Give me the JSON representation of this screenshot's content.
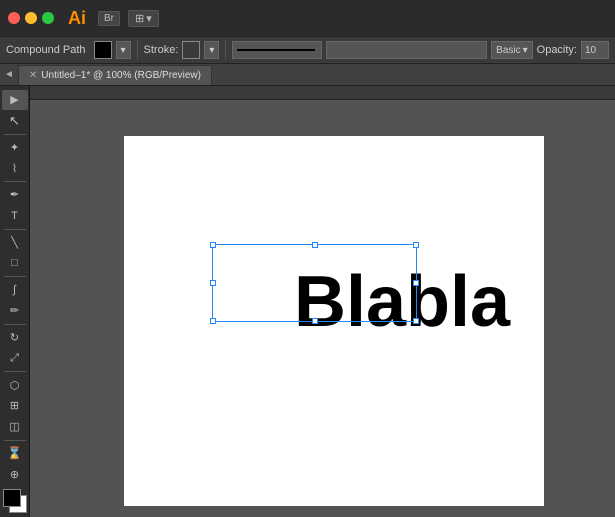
{
  "titlebar": {
    "app_name": "Ai",
    "bridge_label": "Br",
    "window_controls": {
      "close": "close",
      "minimize": "minimize",
      "maximize": "maximize"
    }
  },
  "optionsbar": {
    "object_type": "Compound Path",
    "stroke_label": "Stroke:",
    "basic_label": "Basic",
    "opacity_label": "Opacity:",
    "opacity_value": "10"
  },
  "tabbar": {
    "arrow": "◄",
    "tab_label": "Untitled–1* @ 100% (RGB/Preview)"
  },
  "toolbar": {
    "tools": [
      {
        "name": "selection",
        "icon": "▶"
      },
      {
        "name": "direct-selection",
        "icon": "↖"
      },
      {
        "name": "magic-wand",
        "icon": "✦"
      },
      {
        "name": "lasso",
        "icon": "⌇"
      },
      {
        "name": "pen",
        "icon": "✒"
      },
      {
        "name": "type",
        "icon": "T"
      },
      {
        "name": "line",
        "icon": "╲"
      },
      {
        "name": "rect",
        "icon": "□"
      },
      {
        "name": "paintbrush",
        "icon": "∫"
      },
      {
        "name": "pencil",
        "icon": "✏"
      },
      {
        "name": "rotate",
        "icon": "↻"
      },
      {
        "name": "scale",
        "icon": "⤢"
      },
      {
        "name": "blend",
        "icon": "⬡"
      },
      {
        "name": "mesh",
        "icon": "⊞"
      },
      {
        "name": "gradient",
        "icon": "◫"
      },
      {
        "name": "eyedropper",
        "icon": "⌛"
      },
      {
        "name": "zoom",
        "icon": "⊕"
      }
    ]
  },
  "canvas": {
    "tab_title": "Untitled–1* @ 100% (RGB/Preview)",
    "text_content": "Blabla"
  },
  "colors": {
    "toolbar_bg": "#2e2e2e",
    "options_bg": "#3a3a3a",
    "canvas_bg": "#535353",
    "paper_bg": "#ffffff",
    "title_bg": "#2b2b2b",
    "selection_color": "#2288ff",
    "text_color": "#000000",
    "accent": "#ff8c00"
  }
}
